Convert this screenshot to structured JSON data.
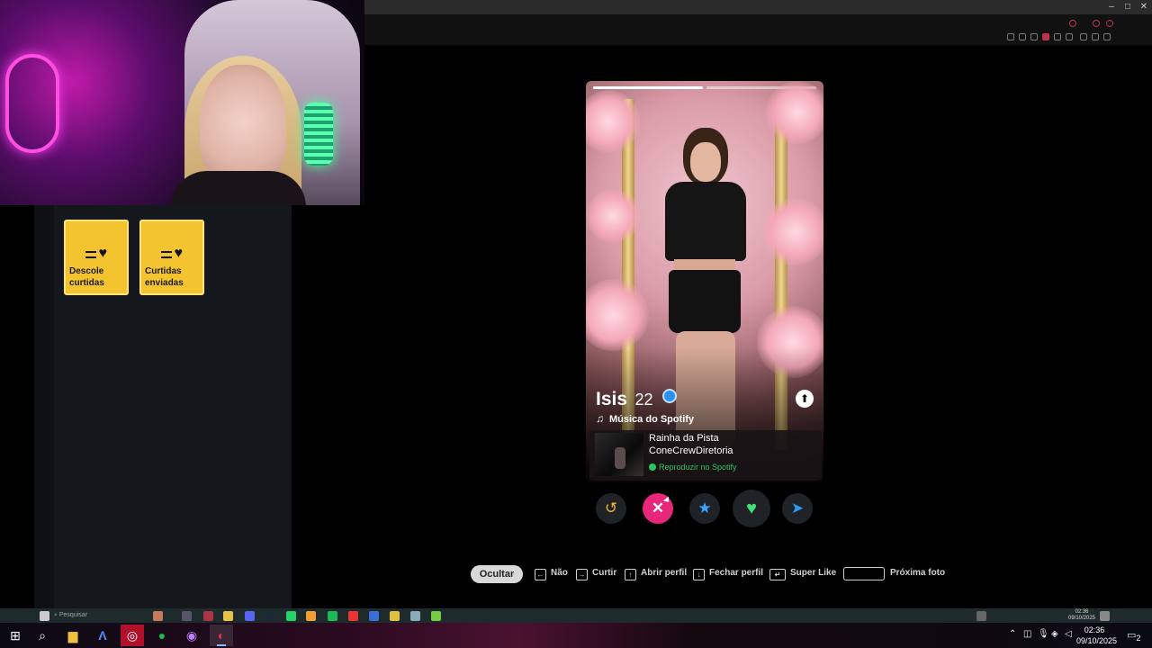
{
  "card": {
    "name": "Isis",
    "age": "22",
    "music_section_title": "Música do Spotify",
    "song": {
      "title": "Rainha da Pista",
      "artist": "ConeCrewDiretoria",
      "play_label": "Reproduzir no Spotify"
    }
  },
  "left_panel": {
    "tiles": [
      {
        "label": "Descole\ncurtidas"
      },
      {
        "label": "Curtidas\nenviadas"
      }
    ]
  },
  "actions": {
    "rewind_icon": "↺",
    "nope_icon": "✕",
    "super_like_icon": "★",
    "like_icon": "♥",
    "boost_icon": "➤"
  },
  "shortcuts": {
    "hide_label": "Ocultar",
    "items": [
      {
        "key": "←",
        "label": "Não"
      },
      {
        "key": "→",
        "label": "Curtir"
      },
      {
        "key": "↑",
        "label": "Abrir perfil"
      },
      {
        "key": "↓",
        "label": "Fechar perfil"
      },
      {
        "key": "↵",
        "label": "Super Like"
      },
      {
        "key": "",
        "label": "Próxima foto"
      }
    ]
  },
  "stream_taskbar": {
    "search_placeholder": "Pesquisar",
    "clock_time": "02:36",
    "clock_date": "09/10/2025"
  },
  "taskbar": {
    "search_icon": "⌕",
    "clock_time": "02:36",
    "clock_date": "09/10/2025",
    "notification_count": "2"
  },
  "colors": {
    "tile_yellow": "#f4c430",
    "nope_pink": "#e8267a",
    "like_green": "#45e07a",
    "super_like_blue": "#3aa4ff",
    "rewind_gold": "#f1b72a",
    "spotify_green": "#2ac65c"
  }
}
